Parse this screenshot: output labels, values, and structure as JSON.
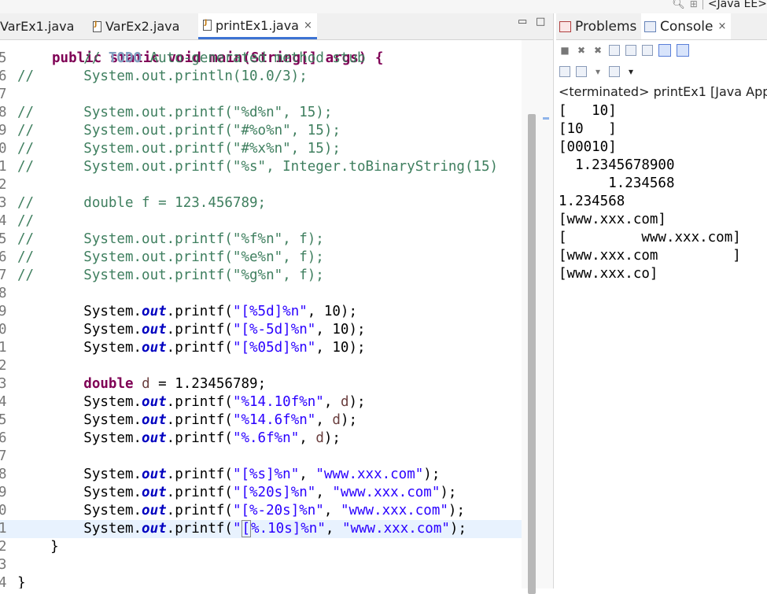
{
  "perspective": {
    "label": "<Java EE>",
    "search_icon": "search-icon",
    "grid_icon": "perspective-grid-icon"
  },
  "editor": {
    "tabs": [
      {
        "label": "VarEx1.java"
      },
      {
        "label": "VarEx2.java"
      },
      {
        "label": "printEx1.java",
        "active": true,
        "close": "×"
      }
    ],
    "minimize": "▭",
    "maximize": "□",
    "header_text": "public static void main(String[] args) {",
    "lines": [
      {
        "no": "5",
        "text": "        // TODO Auto-generated method stub"
      },
      {
        "no": "6",
        "text": "//      System.out.println(10.0/3);"
      },
      {
        "no": "7",
        "text": ""
      },
      {
        "no": "8",
        "text": "//      System.out.printf(\"%d%n\", 15);"
      },
      {
        "no": "9",
        "text": "//      System.out.printf(\"#%o%n\", 15);"
      },
      {
        "no": "0",
        "text": "//      System.out.printf(\"#%x%n\", 15);"
      },
      {
        "no": "1",
        "text": "//      System.out.printf(\"%s\", Integer.toBinaryString(15)"
      },
      {
        "no": "2",
        "text": ""
      },
      {
        "no": "3",
        "text": "//      double f = 123.456789;"
      },
      {
        "no": "4",
        "text": "//"
      },
      {
        "no": "5",
        "text": "//      System.out.printf(\"%f%n\", f);"
      },
      {
        "no": "6",
        "text": "//      System.out.printf(\"%e%n\", f);"
      },
      {
        "no": "7",
        "text": "//      System.out.printf(\"%g%n\", f);"
      },
      {
        "no": "8",
        "text": ""
      },
      {
        "no": "9",
        "text": "        System.out.printf(\"[%5d]%n\", 10);"
      },
      {
        "no": "0",
        "text": "        System.out.printf(\"[%-5d]%n\", 10);"
      },
      {
        "no": "1",
        "text": "        System.out.printf(\"[%05d]%n\", 10);"
      },
      {
        "no": "2",
        "text": ""
      },
      {
        "no": "3",
        "text": "        double d = 1.23456789;"
      },
      {
        "no": "4",
        "text": "        System.out.printf(\"%14.10f%n\", d);"
      },
      {
        "no": "5",
        "text": "        System.out.printf(\"%14.6f%n\", d);"
      },
      {
        "no": "6",
        "text": "        System.out.printf(\"%.6f%n\", d);"
      },
      {
        "no": "7",
        "text": ""
      },
      {
        "no": "8",
        "text": "        System.out.printf(\"[%s]%n\", \"www.xxx.com\");"
      },
      {
        "no": "9",
        "text": "        System.out.printf(\"[%20s]%n\", \"www.xxx.com\");"
      },
      {
        "no": "0",
        "text": "        System.out.printf(\"[%-20s]%n\", \"www.xxx.com\");"
      },
      {
        "no": "1",
        "text": "        System.out.printf(\"[%.10s]%n\", \"www.xxx.com\");"
      },
      {
        "no": "2",
        "text": "    }"
      },
      {
        "no": "3",
        "text": ""
      },
      {
        "no": "4",
        "text": "}"
      }
    ]
  },
  "console": {
    "tabs": [
      {
        "label": "Problems",
        "icon": "problems-icon"
      },
      {
        "label": "Console",
        "icon": "console-icon",
        "active": true,
        "close": "×"
      }
    ],
    "status": "<terminated> printEx1 [Java App",
    "output": [
      "[   10]",
      "[10   ]",
      "[00010]",
      "  1.2345678900",
      "      1.234568",
      "1.234568",
      "[www.xxx.com]",
      "[         www.xxx.com]",
      "[www.xxx.com         ]",
      "[www.xxx.co]"
    ]
  },
  "colors": {
    "comment": "#3f7f5f",
    "keyword": "#7f0055",
    "field": "#0000c0",
    "string": "#2a00ff",
    "variable": "#6a3e3e",
    "current_line": "#e8f2fe",
    "tab_underline": "#3d73d3"
  }
}
